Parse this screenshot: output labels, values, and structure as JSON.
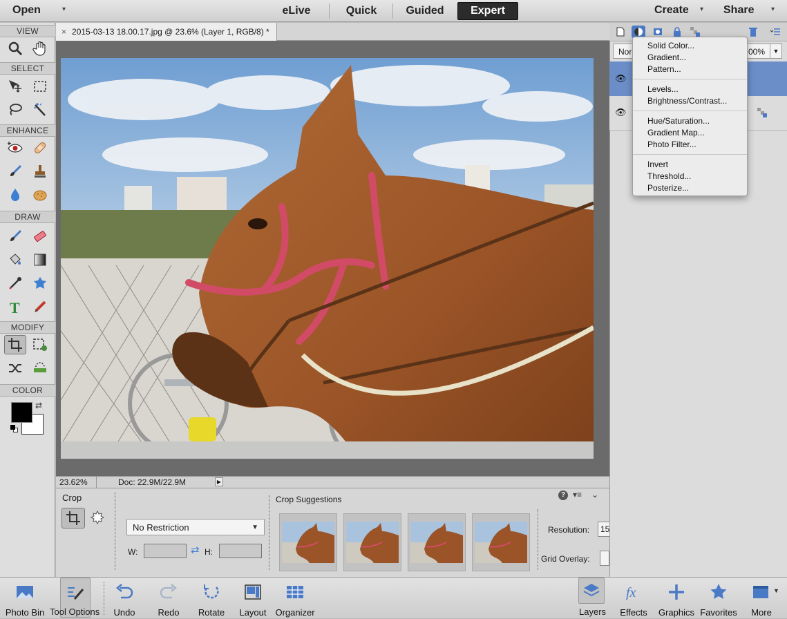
{
  "topbar": {
    "open_label": "Open",
    "modes": [
      "eLive",
      "Quick",
      "Guided",
      "Expert"
    ],
    "active_mode": "Expert",
    "create_label": "Create",
    "share_label": "Share"
  },
  "toolbox": {
    "sections": {
      "view": "VIEW",
      "select": "SELECT",
      "enhance": "ENHANCE",
      "draw": "DRAW",
      "modify": "MODIFY",
      "color": "COLOR"
    }
  },
  "document": {
    "tab_close": "×",
    "tab_title": "2015-03-13 18.00.17.jpg @ 23.6% (Layer 1, RGB/8) *",
    "zoom": "23.62%",
    "doc_size": "Doc: 22.9M/22.9M"
  },
  "tool_options": {
    "tool_name": "Crop",
    "aspect_select": "No Restriction",
    "w_label": "W:",
    "h_label": "H:",
    "suggestions_label": "Crop Suggestions",
    "resolution_label": "Resolution:",
    "resolution_value": "15",
    "grid_overlay_label": "Grid Overlay:"
  },
  "layers_panel": {
    "blend_mode_partial": "Nor",
    "opacity_partial": "00%"
  },
  "adjustment_menu": {
    "groups": [
      [
        "Solid Color...",
        "Gradient...",
        "Pattern..."
      ],
      [
        "Levels...",
        "Brightness/Contrast..."
      ],
      [
        "Hue/Saturation...",
        "Gradient Map...",
        "Photo Filter..."
      ],
      [
        "Invert",
        "Threshold...",
        "Posterize..."
      ]
    ]
  },
  "taskbar": {
    "left": [
      "Photo Bin",
      "Tool Options",
      "Undo",
      "Redo",
      "Rotate",
      "Layout",
      "Organizer"
    ],
    "right": [
      "Layers",
      "Effects",
      "Graphics",
      "Favorites",
      "More"
    ]
  },
  "colors": {
    "accent_blue": "#4a79c6",
    "selected_layer": "#6b8ec8",
    "foreground": "#000000",
    "background": "#ffffff"
  }
}
